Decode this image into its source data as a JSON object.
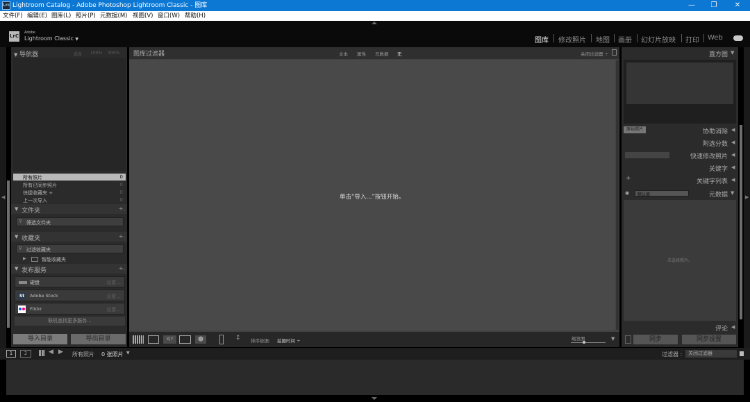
{
  "window": {
    "title": "Lightroom Catalog - Adobe Photoshop Lightroom Classic - 图库",
    "app_icon": "Lrc",
    "minimize": "—",
    "maximize": "❐",
    "close": "✕"
  },
  "menu": [
    "文件(F)",
    "编辑(E)",
    "图库(L)",
    "照片(P)",
    "元数据(M)",
    "视图(V)",
    "窗口(W)",
    "帮助(H)"
  ],
  "identity": {
    "logo": "LrC",
    "adobe": "Adobe",
    "product": "Lightroom Classic",
    "dropdown": "▼"
  },
  "modules": [
    "图库",
    "修改照片",
    "地图",
    "画册",
    "幻灯片放映",
    "打印",
    "Web"
  ],
  "left": {
    "navigator": {
      "title": "导航器",
      "zoom": [
        "适合",
        "100%",
        "300%"
      ]
    },
    "catalog": [
      {
        "label": "所有照片",
        "count": "0"
      },
      {
        "label": "所有已同步照片",
        "count": "0"
      },
      {
        "label": "快捷收藏夹 +",
        "count": "0"
      },
      {
        "label": "上一次导入",
        "count": "0"
      }
    ],
    "folders": {
      "title": "文件夹",
      "add": "+.",
      "filter": "筛选文件夹"
    },
    "collections": {
      "title": "收藏夹",
      "add": "+.",
      "filter": "过滤收藏夹",
      "smart": "智能收藏夹"
    },
    "publish": {
      "title": "发布服务",
      "add": "+.",
      "services": [
        {
          "name": "硬盘",
          "setup": "设置..."
        },
        {
          "name": "Adobe Stock",
          "setup": "设置..."
        },
        {
          "name": "Flickr",
          "setup": "设置..."
        }
      ],
      "find_more": "联机查找更多服务..."
    },
    "import_btn": "导入目录",
    "export_btn": "导出目录"
  },
  "center": {
    "filter_title": "图库过滤器",
    "filter_tabs": [
      "文本",
      "属性",
      "元数据",
      "无"
    ],
    "filter_preset": "关闭过滤器 ÷",
    "empty_msg": "单击“导入...”按钮开始。",
    "sort_label": "排序依据:",
    "sort_value": "拍摄时间 ÷",
    "thumb_label": "缩览图"
  },
  "right": {
    "histogram": "直方图",
    "original_photo": "原始照片",
    "quick_develop": "快速修改照片",
    "keywords": "关键字",
    "keyword_list": "关键字列表",
    "metadata": "元数据",
    "meta_preset": "默认值",
    "no_selection": "未选择照片。",
    "comments": "评论",
    "sync_meta": "同步",
    "sync_settings": "同步设置",
    "extra_rows": [
      "协助消除",
      "附选分数"
    ]
  },
  "filmstrip": {
    "screen1": "1",
    "screen2": "2",
    "source": "所有照片",
    "count": "0 张照片",
    "filter_label": "过滤器 :",
    "filter_value": "关闭过滤器"
  }
}
